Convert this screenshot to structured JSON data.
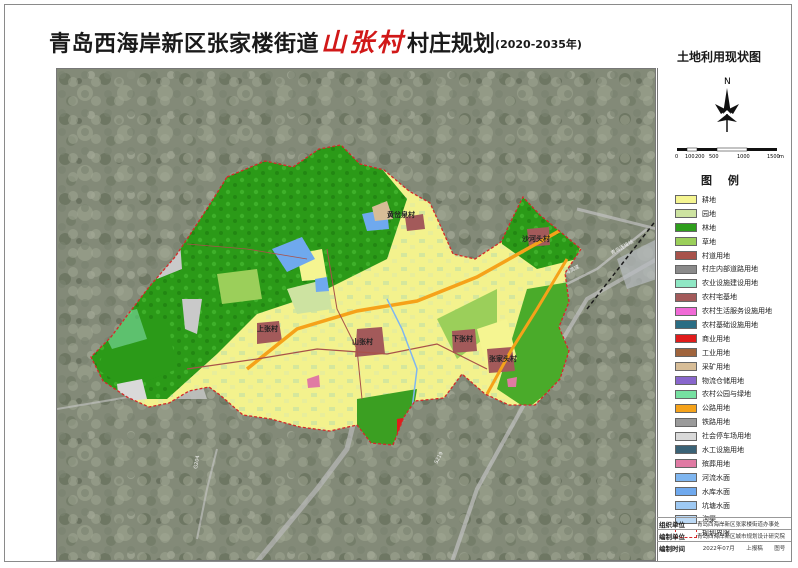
{
  "title": {
    "part1": "青岛西海岸新区张家楼街道",
    "village": "山张村",
    "part2": "村庄规划",
    "years": "(2020-2035年)"
  },
  "subtitle": "土地利用现状图",
  "north_arrow": {
    "label": "N"
  },
  "scale_bar": {
    "ticks": [
      "0",
      "100",
      "200",
      "500",
      "1000",
      "1500"
    ],
    "unit": "m"
  },
  "legend": {
    "title": "图 例",
    "items": [
      {
        "label": "耕地",
        "color": "#f5f591"
      },
      {
        "label": "园地",
        "color": "#cde3a1"
      },
      {
        "label": "林地",
        "color": "#2e9e1c"
      },
      {
        "label": "草地",
        "color": "#9bcf5a"
      },
      {
        "label": "村道用地",
        "color": "#a8524a"
      },
      {
        "label": "村庄内部道路用地",
        "color": "#8a8a8a"
      },
      {
        "label": "农业设施建设用地",
        "color": "#8fe7c4"
      },
      {
        "label": "农村宅基地",
        "color": "#a35a5a"
      },
      {
        "label": "农村生活服务设施用地",
        "color": "#f06ad6"
      },
      {
        "label": "农村基础设施用地",
        "color": "#2a6d84"
      },
      {
        "label": "商业用地",
        "color": "#e01b1b"
      },
      {
        "label": "工业用地",
        "color": "#a0643c"
      },
      {
        "label": "采矿用地",
        "color": "#d7bd97"
      },
      {
        "label": "物流仓储用地",
        "color": "#8866cc"
      },
      {
        "label": "农村公园与绿地",
        "color": "#76e0a1"
      },
      {
        "label": "公路用地",
        "color": "#f5a21a"
      },
      {
        "label": "铁路用地",
        "color": "#9a9a9a"
      },
      {
        "label": "社会停车场用地",
        "color": "#d9d9d9"
      },
      {
        "label": "水工设施用地",
        "color": "#3a6276"
      },
      {
        "label": "殡葬用地",
        "color": "#e07aa3"
      },
      {
        "label": "河流水面",
        "color": "#7fb6f0"
      },
      {
        "label": "水库水面",
        "color": "#6fa9ee"
      },
      {
        "label": "坑塘水面",
        "color": "#9ec9f3"
      },
      {
        "label": "沟渠",
        "color": "#bcd9f5"
      },
      {
        "label": "规划界限",
        "color": "#ffffff"
      }
    ]
  },
  "village_labels": {
    "v1": "黄岔泉村",
    "v2": "沙河头村",
    "v3": "山张村",
    "v4": "上张村",
    "v5": "下张村",
    "v6": "张家头村"
  },
  "info": {
    "org_key": "组织单位",
    "org_val": "青岛西海岸新区张家楼街道办事处",
    "compiler_key": "编制单位",
    "compiler_val": "青岛西海岸新区城市规划设计研究院",
    "time_key": "编制时间",
    "time_val": "2022年07月",
    "stage": "上报稿",
    "fig": "图号"
  }
}
